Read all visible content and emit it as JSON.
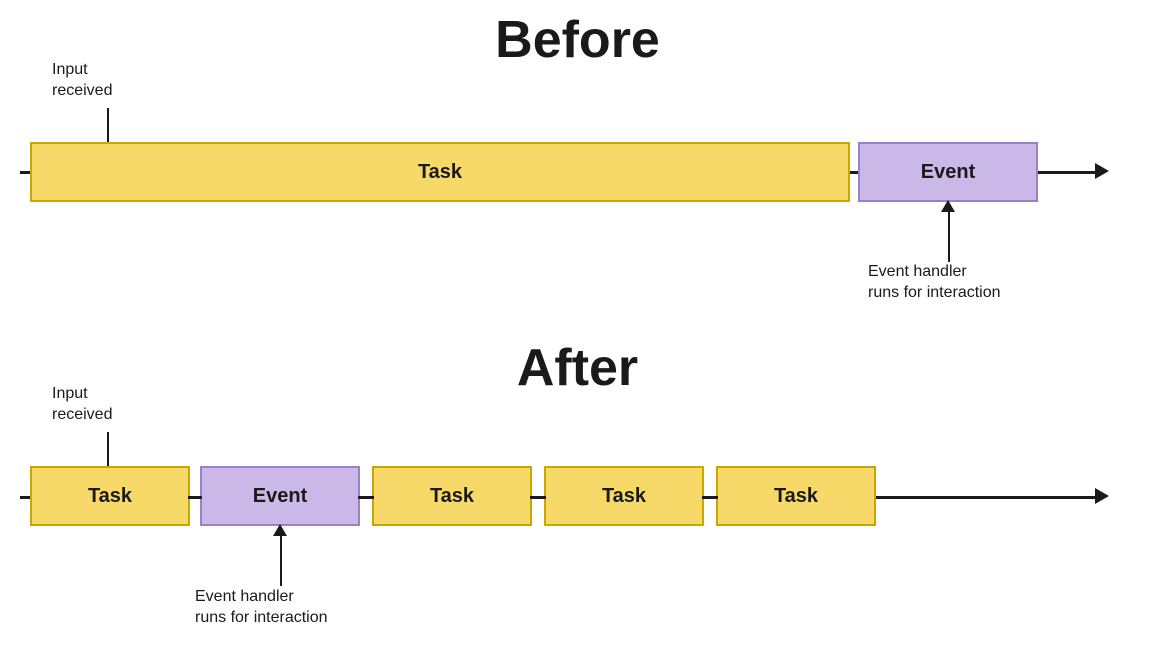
{
  "before": {
    "title": "Before",
    "input_received_label": "Input\nreceived",
    "task_label": "Task",
    "event_label": "Event",
    "event_handler_label": "Event handler\nruns for interaction"
  },
  "after": {
    "title": "After",
    "input_received_label": "Input\nreceived",
    "task_label": "Task",
    "event_label": "Event",
    "task2_label": "Task",
    "task3_label": "Task",
    "task4_label": "Task",
    "event_handler_label": "Event handler\nruns for interaction"
  },
  "colors": {
    "task_bg": "#f7d96a",
    "task_border": "#c8a800",
    "event_bg": "#c9b8e8",
    "event_border": "#9980c8",
    "line": "#1a1a1a"
  }
}
